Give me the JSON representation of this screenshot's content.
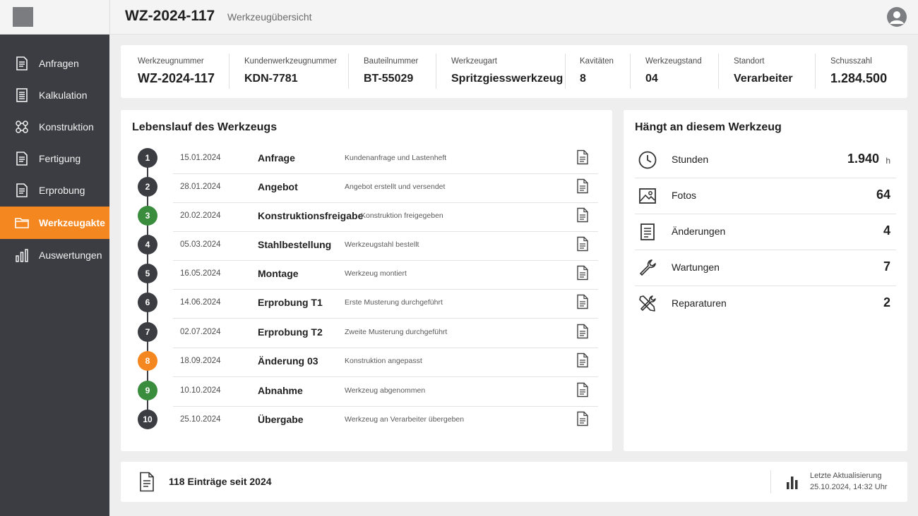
{
  "header": {
    "title": "WZ-2024-117",
    "subtitle": "Werkzeugübersicht"
  },
  "sidebar": {
    "items": [
      {
        "label": "Anfragen",
        "icon": "document-icon",
        "active": false
      },
      {
        "label": "Kalkulation",
        "icon": "list-document-icon",
        "active": false
      },
      {
        "label": "Konstruktion",
        "icon": "nodes-icon",
        "active": false
      },
      {
        "label": "Fertigung",
        "icon": "document-icon",
        "active": false
      },
      {
        "label": "Erprobung",
        "icon": "document-icon",
        "active": false
      },
      {
        "label": "Werkzeugakte",
        "icon": "folder-icon",
        "active": true
      },
      {
        "label": "Auswertungen",
        "icon": "bar-chart-icon",
        "active": false
      }
    ]
  },
  "info": [
    {
      "label": "Werkzeugnummer",
      "value": "WZ-2024-117"
    },
    {
      "label": "Kundenwerkzeugnummer",
      "value": "KDN-7781"
    },
    {
      "label": "Bauteilnummer",
      "value": "BT-55029"
    },
    {
      "label": "Werkzeugart",
      "value": "Spritzgiesswerkzeug"
    },
    {
      "label": "Kavitäten",
      "value": "8"
    },
    {
      "label": "Werkzeugstand",
      "value": "04"
    },
    {
      "label": "Standort",
      "value": "Verarbeiter"
    },
    {
      "label": "Schusszahl",
      "value": "1.284.500"
    }
  ],
  "lifecycle": {
    "title": "Lebenslauf des Werkzeugs",
    "entries": [
      {
        "number": "1",
        "date": "15.01.2024",
        "title": "Anfrage",
        "description": "Kundenanfrage und Lastenheft",
        "status": "default"
      },
      {
        "number": "2",
        "date": "28.01.2024",
        "title": "Angebot",
        "description": "Angebot erstellt und versendet",
        "status": "default"
      },
      {
        "number": "3",
        "date": "20.02.2024",
        "title": "Konstruktionsfreigabe",
        "description": "Konstruktion freigegeben",
        "status": "green"
      },
      {
        "number": "4",
        "date": "05.03.2024",
        "title": "Stahlbestellung",
        "description": "Werkzeugstahl bestellt",
        "status": "default"
      },
      {
        "number": "5",
        "date": "16.05.2024",
        "title": "Montage",
        "description": "Werkzeug montiert",
        "status": "default"
      },
      {
        "number": "6",
        "date": "14.06.2024",
        "title": "Erprobung T1",
        "description": "Erste Musterung durchgeführt",
        "status": "default"
      },
      {
        "number": "7",
        "date": "02.07.2024",
        "title": "Erprobung T2",
        "description": "Zweite Musterung durchgeführt",
        "status": "default"
      },
      {
        "number": "8",
        "date": "18.09.2024",
        "title": "Änderung 03",
        "description": "Konstruktion angepasst",
        "status": "orange"
      },
      {
        "number": "9",
        "date": "10.10.2024",
        "title": "Abnahme",
        "description": "Werkzeug abgenommen",
        "status": "green"
      },
      {
        "number": "10",
        "date": "25.10.2024",
        "title": "Übergabe",
        "description": "Werkzeug an Verarbeiter übergeben",
        "status": "default"
      }
    ]
  },
  "attachments": {
    "title": "Hängt an diesem Werkzeug",
    "items": [
      {
        "label": "Stunden",
        "value": "1.940",
        "unit": "h",
        "icon": "clock-icon"
      },
      {
        "label": "Fotos",
        "value": "64",
        "unit": "",
        "icon": "image-icon"
      },
      {
        "label": "Änderungen",
        "value": "4",
        "unit": "",
        "icon": "document-icon"
      },
      {
        "label": "Wartungen",
        "value": "7",
        "unit": "",
        "icon": "wrench-icon"
      },
      {
        "label": "Reparaturen",
        "value": "2",
        "unit": "",
        "icon": "tools-icon"
      }
    ]
  },
  "footer": {
    "entries_text": "118 Einträge seit 2024",
    "update_label": "Letzte Aktualisierung",
    "update_value": "25.10.2024, 14:32 Uhr"
  },
  "colors": {
    "accent": "#f4871f",
    "sidebar": "#3b3d42",
    "green": "#3b8d3e"
  }
}
